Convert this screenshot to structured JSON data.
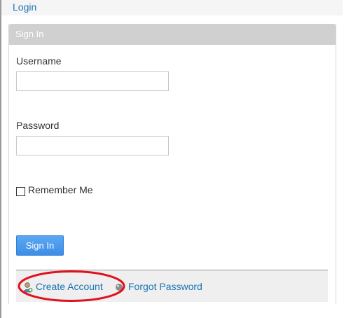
{
  "topbar": {
    "login_link": "Login"
  },
  "panel": {
    "title": "Sign In",
    "username_label": "Username",
    "username_value": "",
    "password_label": "Password",
    "password_value": "",
    "remember_label": "Remember Me",
    "remember_checked": false,
    "signin_button": "Sign In"
  },
  "footer": {
    "create_account": "Create Account",
    "create_account_icon": "add-user-icon",
    "forgot_password": "Forgot Password",
    "forgot_password_icon": "gray-bullet-icon"
  },
  "annotation": {
    "highlight_color": "#e0121f"
  },
  "colors": {
    "link": "#1a74b3",
    "header": "#d0d0d0",
    "button": "#3e8ee6"
  }
}
